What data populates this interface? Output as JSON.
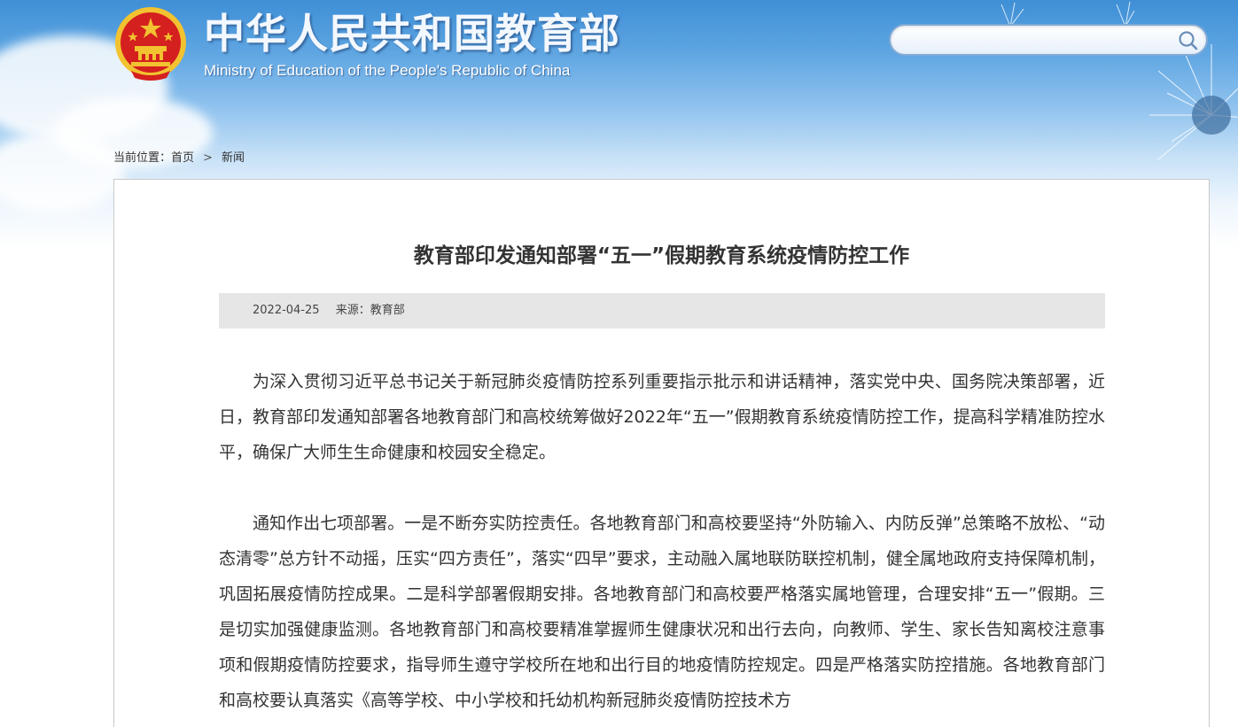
{
  "header": {
    "site_title": "中华人民共和国教育部",
    "site_subtitle": "Ministry of Education of the People's Republic of China",
    "search": {
      "value": "",
      "placeholder": ""
    }
  },
  "icons": {
    "emblem": "national-emblem-icon",
    "search": "search-icon"
  },
  "breadcrumb": {
    "prefix": "当前位置：",
    "items": [
      "首页",
      "新闻"
    ],
    "separator": ">"
  },
  "article": {
    "title": "教育部印发通知部署“五一”假期教育系统疫情防控工作",
    "date": "2022-04-25",
    "source": "来源：教育部",
    "paragraphs": [
      "为深入贯彻习近平总书记关于新冠肺炎疫情防控系列重要指示批示和讲话精神，落实党中央、国务院决策部署，近日，教育部印发通知部署各地教育部门和高校统筹做好2022年“五一”假期教育系统疫情防控工作，提高科学精准防控水平，确保广大师生生命健康和校园安全稳定。",
      "通知作出七项部署。一是不断夯实防控责任。各地教育部门和高校要坚持“外防输入、内防反弹”总策略不放松、“动态清零”总方针不动摇，压实“四方责任”，落实“四早”要求，主动融入属地联防联控机制，健全属地政府支持保障机制，巩固拓展疫情防控成果。二是科学部署假期安排。各地教育部门和高校要严格落实属地管理，合理安排“五一”假期。三是切实加强健康监测。各地教育部门和高校要精准掌握师生健康状况和出行去向，向教师、学生、家长告知离校注意事项和假期疫情防控要求，指导师生遵守学校所在地和出行目的地疫情防控规定。四是严格落实防控措施。各地教育部门和高校要认真落实《高等学校、中小学校和托幼机构新冠肺炎疫情防控技术方"
    ]
  },
  "colors": {
    "sky_top": "#3f8fd6",
    "title_text": "#333333",
    "meta_bar": "#e6e6e6",
    "emblem_red": "#d4201f",
    "emblem_gold": "#f2c230"
  }
}
